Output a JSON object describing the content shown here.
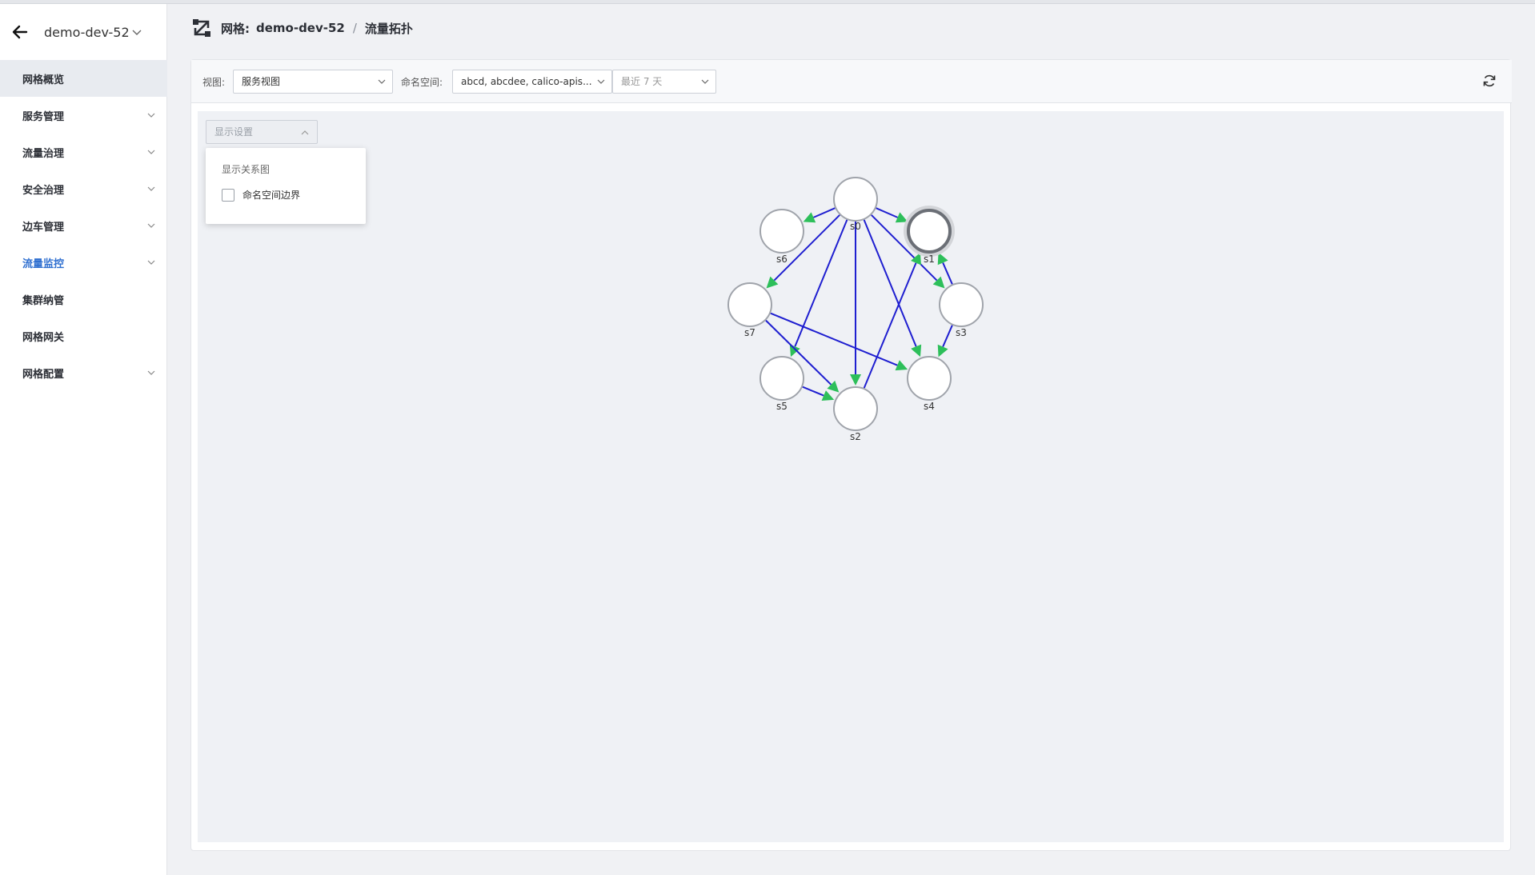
{
  "sidebar": {
    "mesh_name": "demo-dev-52",
    "items": [
      {
        "label": "网格概览",
        "has_children": false
      },
      {
        "label": "服务管理",
        "has_children": true
      },
      {
        "label": "流量治理",
        "has_children": true
      },
      {
        "label": "安全治理",
        "has_children": true
      },
      {
        "label": "边车管理",
        "has_children": true
      },
      {
        "label": "流量监控",
        "has_children": true
      },
      {
        "label": "集群纳管",
        "has_children": false
      },
      {
        "label": "网格网关",
        "has_children": false
      },
      {
        "label": "网格配置",
        "has_children": true
      }
    ],
    "active_item": "网格概览",
    "highlight_item": "流量监控"
  },
  "header": {
    "mesh_prefix": "网格:",
    "mesh_name": "demo-dev-52",
    "separator": "/",
    "page_title": "流量拓扑"
  },
  "toolbar": {
    "view_label": "视图:",
    "view_value": "服务视图",
    "namespace_label": "命名空间:",
    "namespace_value": "abcd, abcdee, calico-apis...",
    "time_value": "最近 7 天"
  },
  "display_settings": {
    "button_label": "显示设置",
    "dropdown_title": "显示关系图",
    "option_label": "命名空间边界",
    "option_checked": false
  },
  "topology": {
    "nodes": [
      {
        "id": "s0",
        "selected": false
      },
      {
        "id": "s1",
        "selected": true
      },
      {
        "id": "s2",
        "selected": false
      },
      {
        "id": "s3",
        "selected": false
      },
      {
        "id": "s4",
        "selected": false
      },
      {
        "id": "s5",
        "selected": false
      },
      {
        "id": "s6",
        "selected": false
      },
      {
        "id": "s7",
        "selected": false
      }
    ],
    "edges": [
      [
        "s0",
        "s6"
      ],
      [
        "s0",
        "s1"
      ],
      [
        "s0",
        "s7"
      ],
      [
        "s0",
        "s5"
      ],
      [
        "s0",
        "s2"
      ],
      [
        "s0",
        "s4"
      ],
      [
        "s0",
        "s3"
      ],
      [
        "s3",
        "s1"
      ],
      [
        "s3",
        "s4"
      ],
      [
        "s2",
        "s1"
      ],
      [
        "s7",
        "s2"
      ],
      [
        "s7",
        "s4"
      ],
      [
        "s5",
        "s2"
      ]
    ],
    "colors": {
      "edge": "#1f1fd0",
      "arrow": "#2dbf5a",
      "node_stroke": "#a0a4ab",
      "node_fill": "#ffffff",
      "selected_ring": "#6b6f76"
    }
  }
}
